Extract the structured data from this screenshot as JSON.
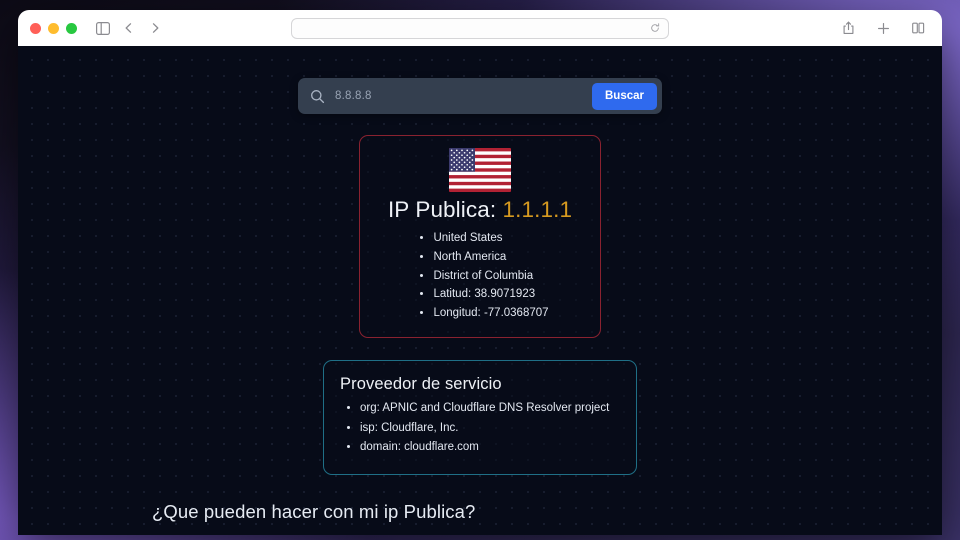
{
  "browser": {
    "traffic_lights": [
      "close",
      "minimize",
      "maximize"
    ],
    "sidebar_toggle_label": "Sidebar",
    "back_label": "Back",
    "forward_label": "Forward",
    "url_value": "",
    "url_placeholder": "",
    "reload_label": "Reload",
    "share_label": "Share",
    "new_tab_label": "New Tab",
    "tab_overview_label": "Tab Overview"
  },
  "search": {
    "icon": "search-icon",
    "value": "",
    "placeholder": "8.8.8.8",
    "button_label": "Buscar"
  },
  "ip_card": {
    "flag": "united-states-flag",
    "title_prefix": "IP Publica:",
    "ip": "1.1.1.1",
    "details": [
      "United States",
      "North America",
      "District of Columbia",
      "Latitud: 38.9071923",
      "Longitud: -77.0368707"
    ],
    "border_color": "#8a2230",
    "ip_color": "#d69a20"
  },
  "isp_card": {
    "title": "Proveedor de servicio",
    "details": [
      "org: APNIC and Cloudflare DNS Resolver project",
      "isp: Cloudflare, Inc.",
      "domain: cloudflare.com"
    ],
    "border_color": "#1f6f86"
  },
  "section": {
    "heading": "¿Que pueden hacer con mi ip Publica?"
  }
}
